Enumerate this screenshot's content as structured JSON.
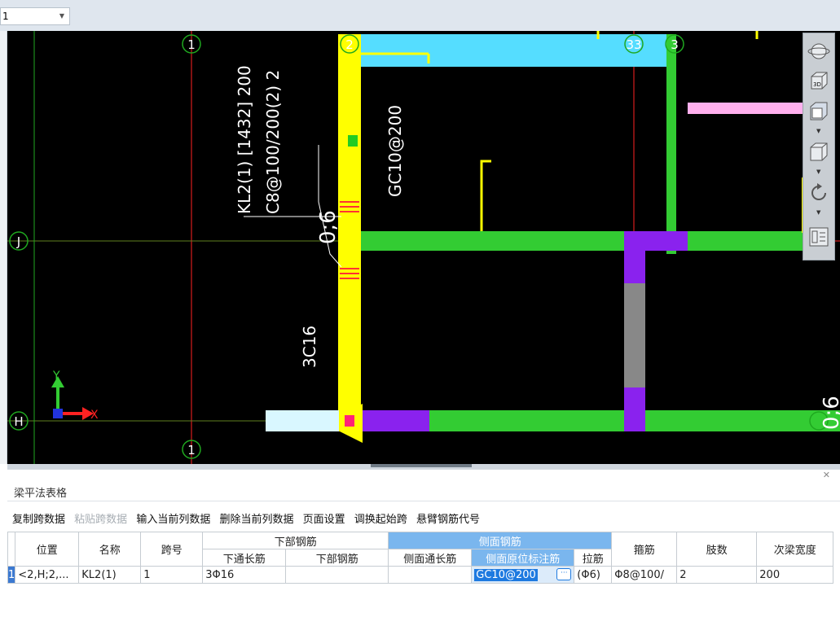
{
  "toolbar": {
    "layer_select_value": "1"
  },
  "canvas": {
    "axis_labels": {
      "col1_top": "1",
      "col2_top": "2",
      "col33_top": "33",
      "col3_top": "3",
      "row_j": "J",
      "row_h": "H",
      "col1_bottom": "1"
    },
    "annotations": {
      "beam_name": "KL2(1) [1432] 200",
      "stirrup": "C8@100/200(2) 2",
      "elevation": "0;6",
      "side_rebar": "GC10@200",
      "bottom_rebar": "3C16",
      "right_elevation": "0;6"
    },
    "ucs": {
      "x_label": "X",
      "y_label": "Y"
    }
  },
  "viewbar": {
    "btn_3d_label": "3D"
  },
  "panel": {
    "title": "梁平法表格",
    "toolbar": [
      {
        "label": "复制跨数据",
        "enabled": true
      },
      {
        "label": "粘贴跨数据",
        "enabled": false
      },
      {
        "label": "输入当前列数据",
        "enabled": true
      },
      {
        "label": "删除当前列数据",
        "enabled": true
      },
      {
        "label": "页面设置",
        "enabled": true
      },
      {
        "label": "调换起始跨",
        "enabled": true
      },
      {
        "label": "悬臂钢筋代号",
        "enabled": true
      }
    ],
    "headers": {
      "position": "位置",
      "name": "名称",
      "span": "跨号",
      "bottom_group": "下部钢筋",
      "bottom_through": "下通长筋",
      "bottom_rebar": "下部钢筋",
      "side_group": "侧面钢筋",
      "side_through": "侧面通长筋",
      "side_marked": "侧面原位标注筋",
      "tie": "拉筋",
      "stirrup": "箍筋",
      "legs": "肢数",
      "secondary_width": "次梁宽度"
    },
    "row": {
      "num": "1",
      "position": "<2,H;2,...",
      "name": "KL2(1)",
      "span": "1",
      "bottom_through": "3Φ16",
      "bottom_rebar": "",
      "side_through": "",
      "side_marked": "GC10@200",
      "tie": "(Φ6)",
      "stirrup": "Φ8@100/",
      "legs": "2",
      "secondary_width": "200"
    }
  },
  "colors": {
    "canvas_bg": "#000000",
    "beam_yellow": "#ffff00",
    "beam_green": "#33cc33",
    "beam_cyan": "#55ddff",
    "column_purple": "#8a22ee",
    "grid_red": "#ff2222",
    "axis_green": "#1fa81f",
    "pink": "#ffb0ee",
    "selection_blue": "#1e7ae0"
  }
}
